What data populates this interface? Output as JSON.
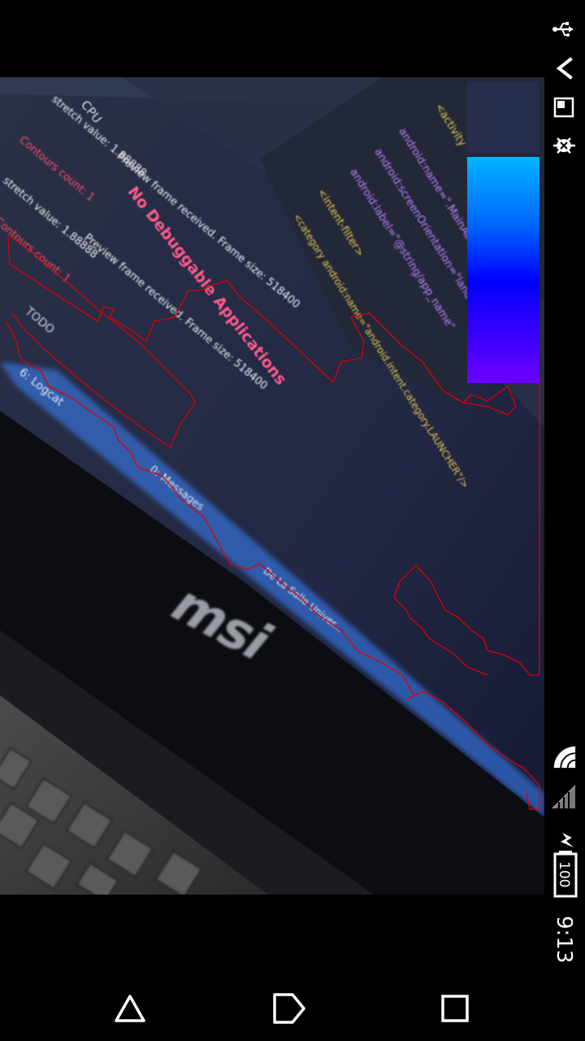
{
  "status_bar": {
    "battery_level": "100",
    "time": "9:13",
    "icons": [
      "usb-icon",
      "back-arrow-icon",
      "picture-in-picture-icon",
      "bug-icon",
      "wifi-icon",
      "signal-icon",
      "charging-bolt-icon",
      "battery-icon"
    ]
  },
  "camera_preview": {
    "scene_texts": {
      "no_debuggable": "No Debuggable Applications",
      "cpu": "CPU",
      "todo": "TODO",
      "brand": "msi",
      "log_1": "stretch value: 1.88888",
      "log_2": "Preview frame received. Frame size: 518400",
      "log_3": "Contours count: 1",
      "log_4": "stretch value: 1.88888",
      "log_5": "Preview frame received. Frame size: 518400",
      "log_6": "Contours count: 1",
      "tab_1": "6: Logcat",
      "tab_2": "0: Messages",
      "taskbar_1": "De La Salle Univer...",
      "code_1": "<activity",
      "code_2": "android:name=\".MainActivity\"",
      "code_3": "android:screenOrientation=\"landscape\"",
      "code_4": "android:label=\"@string/app_name\"",
      "code_5": "<intent-filter>",
      "code_6": "<category android:name=\"android.intent.category.LAUNCHER\"/>"
    },
    "overlay_colors": {
      "swatch": "#262e4b",
      "gradient": [
        "#00b4ff",
        "#0066ff",
        "#0000ff",
        "#6e00ff"
      ],
      "contour": "#e00000"
    }
  },
  "nav_bar": {
    "buttons": [
      "back-triangle-icon",
      "home-icon",
      "recents-square-icon"
    ]
  }
}
